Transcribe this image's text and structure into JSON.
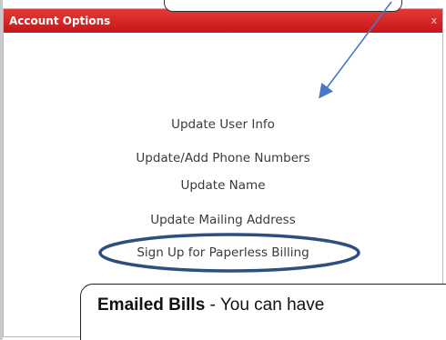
{
  "dialog": {
    "title": "Account Options",
    "close_label": "x",
    "links": [
      {
        "label": "Update User Info"
      },
      {
        "label": "Update/Add Phone Numbers"
      },
      {
        "label": "Update Name"
      },
      {
        "label": "Update Mailing Address"
      },
      {
        "label": "Sign Up for Paperless Billing"
      }
    ]
  },
  "callout": {
    "bold_text": "Emailed Bills",
    "rest_text": " - You can have"
  },
  "colors": {
    "titlebar": "#d2201f",
    "highlight_ellipse": "#2b4f80",
    "arrow": "#4a78c4"
  }
}
